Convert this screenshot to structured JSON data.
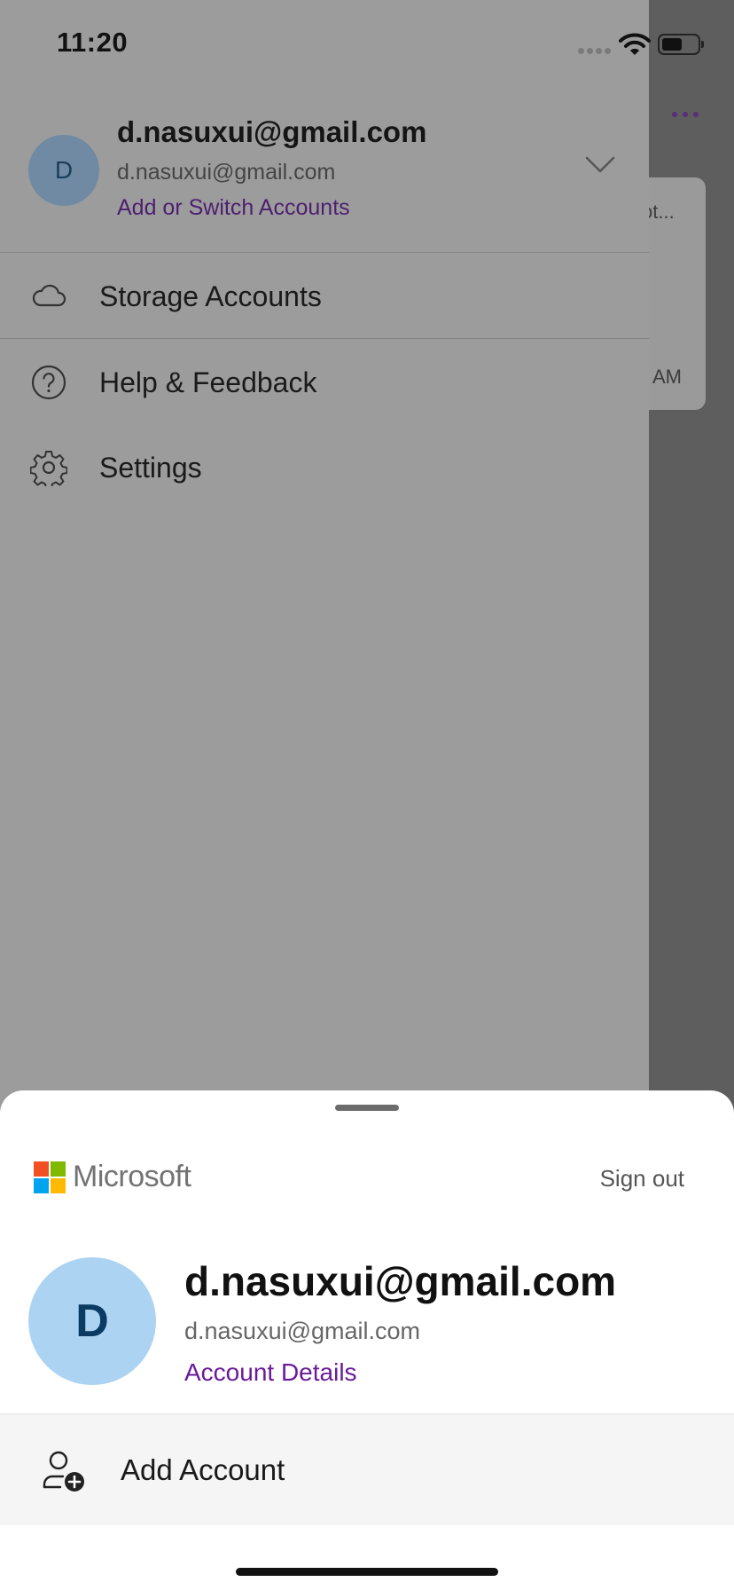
{
  "status_bar": {
    "time": "11:20"
  },
  "background": {
    "card_title_fragment": "ot...",
    "card_time_fragment": "AM"
  },
  "drawer": {
    "account": {
      "avatar_letter": "D",
      "name": "d.nasuxui@gmail.com",
      "email": "d.nasuxui@gmail.com",
      "switch_label": "Add or Switch Accounts"
    },
    "menu": [
      {
        "label": "Storage Accounts",
        "icon": "cloud-icon"
      },
      {
        "label": "Help & Feedback",
        "icon": "help-icon"
      },
      {
        "label": "Settings",
        "icon": "gear-icon"
      }
    ]
  },
  "sheet": {
    "brand": "Microsoft",
    "sign_out": "Sign out",
    "avatar_letter": "D",
    "name": "d.nasuxui@gmail.com",
    "email": "d.nasuxui@gmail.com",
    "details_label": "Account Details",
    "add_account": "Add Account"
  },
  "colors": {
    "accent_purple": "#6a1a9a",
    "avatar_blue": "#acd3f1",
    "ms_red": "#f25022",
    "ms_green": "#7fba00",
    "ms_blue": "#00a4ef",
    "ms_yellow": "#ffb900"
  }
}
